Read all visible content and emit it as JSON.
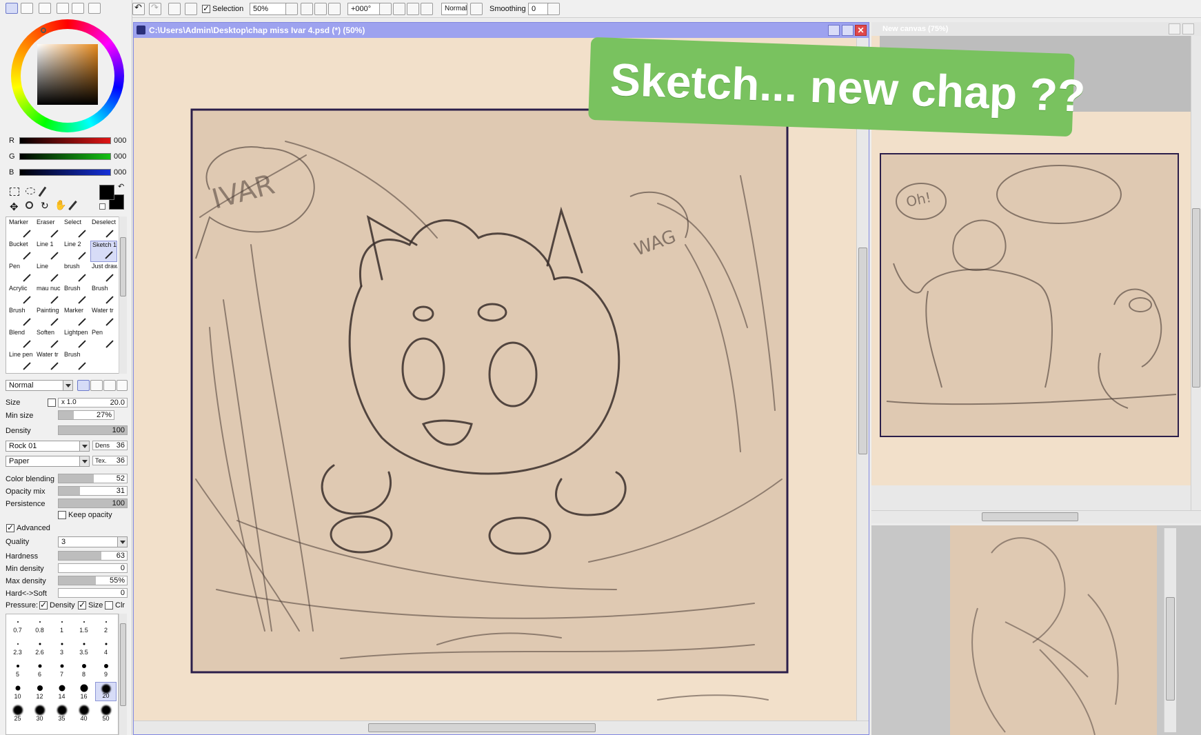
{
  "left_panel": {
    "rgb": [
      {
        "label": "R",
        "value": "000",
        "color": "#e01515"
      },
      {
        "label": "G",
        "value": "000",
        "color": "#15c015"
      },
      {
        "label": "B",
        "value": "000",
        "color": "#1530d8"
      }
    ],
    "tools": [
      {
        "label": "Marker"
      },
      {
        "label": "Eraser"
      },
      {
        "label": "Select"
      },
      {
        "label": "Deselect"
      },
      {
        "label": "Bucket"
      },
      {
        "label": "Line 1"
      },
      {
        "label": "Line 2"
      },
      {
        "label": "Sketch 1",
        "selected": true
      },
      {
        "label": "Pen"
      },
      {
        "label": "Line"
      },
      {
        "label": "brush"
      },
      {
        "label": "Just draw"
      },
      {
        "label": "Acrylic"
      },
      {
        "label": "mau nuc"
      },
      {
        "label": "Brush"
      },
      {
        "label": "Brush"
      },
      {
        "label": "Brush"
      },
      {
        "label": "Painting"
      },
      {
        "label": "Marker"
      },
      {
        "label": "Water tr"
      },
      {
        "label": "Blend"
      },
      {
        "label": "Soften"
      },
      {
        "label": "Lightpen"
      },
      {
        "label": "Pen"
      },
      {
        "label": "Line pen"
      },
      {
        "label": "Water tr"
      },
      {
        "label": "Brush"
      }
    ],
    "blend_mode": "Normal",
    "size": {
      "label": "Size",
      "multiplier": "x 1.0",
      "value": "20.0"
    },
    "min_size": {
      "label": "Min size",
      "value": "27%",
      "fraction": 0.27
    },
    "density": {
      "label": "Density",
      "value": "100",
      "fraction": 1.0
    },
    "texture1": {
      "name": "Rock 01",
      "tag": "Dens",
      "value": "36"
    },
    "texture2": {
      "name": "Paper",
      "tag": "Tex.",
      "value": "36"
    },
    "color_blending": {
      "label": "Color blending",
      "value": "52",
      "fraction": 0.52
    },
    "opacity_mix": {
      "label": "Opacity mix",
      "value": "31",
      "fraction": 0.31
    },
    "persistence": {
      "label": "Persistence",
      "value": "100",
      "fraction": 1.0
    },
    "keep_opacity": "Keep opacity",
    "advanced": "Advanced",
    "quality": {
      "label": "Quality",
      "value": "3"
    },
    "hardness": {
      "label": "Hardness",
      "value": "63",
      "fraction": 0.63
    },
    "min_density": {
      "label": "Min density",
      "value": "0",
      "fraction": 0
    },
    "max_density": {
      "label": "Max density",
      "value": "55%",
      "fraction": 0.55
    },
    "hard_soft": {
      "label": "Hard<->Soft",
      "value": "0",
      "fraction": 0
    },
    "pressure": {
      "label": "Pressure:",
      "density": "Density",
      "size": "Size",
      "clr": "Clr"
    },
    "brush_sizes": [
      "0.7",
      "0.8",
      "1",
      "1.5",
      "2",
      "2.3",
      "2.6",
      "3",
      "3.5",
      "4",
      "5",
      "6",
      "7",
      "8",
      "9",
      "10",
      "12",
      "14",
      "16",
      "20",
      "25",
      "30",
      "35",
      "40",
      "50"
    ],
    "selected_brush_size": "20"
  },
  "toolbar": {
    "selection_label": "Selection",
    "zoom": "50%",
    "rotation": "+000°",
    "mode": "Normal",
    "smoothing_label": "Smoothing",
    "smoothing_value": "0"
  },
  "document": {
    "title": "C:\\Users\\Admin\\Desktop\\chap miss Ivar 4.psd (*) (50%)",
    "close_glyph": "✕"
  },
  "navigator": {
    "title": "New canvas (75%)"
  },
  "banner": {
    "text": "Sketch... new chap ??",
    "color": "#79c25f"
  },
  "sketch_text": {
    "bubble1": "IVAR",
    "wag": "WAG",
    "oh": "Oh!"
  }
}
